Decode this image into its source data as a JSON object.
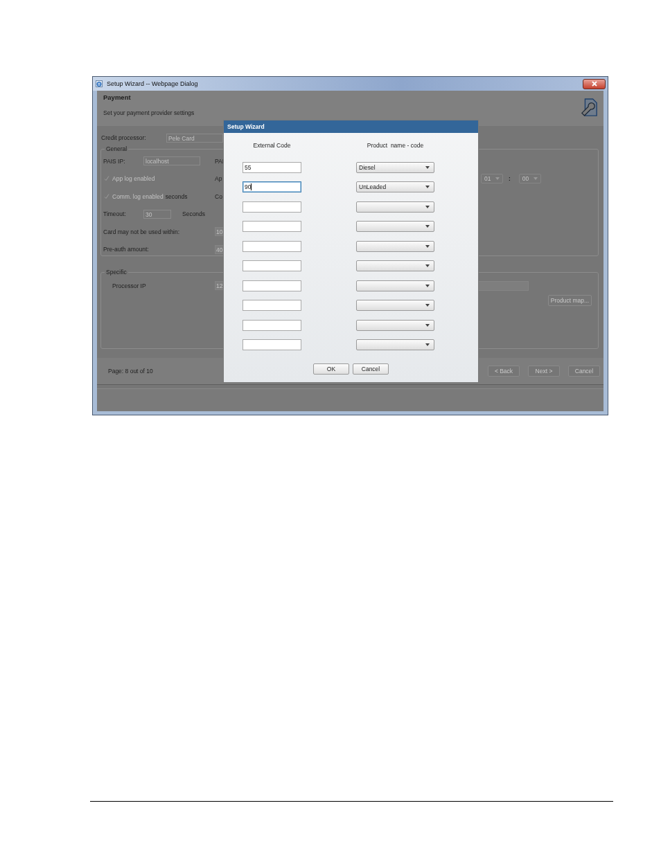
{
  "window": {
    "title": "Setup Wizard -- Webpage Dialog"
  },
  "header": {
    "title": "Payment",
    "subtitle": "Set your payment provider settings"
  },
  "credit_processor": {
    "label": "Credit processor:",
    "value": "Pele Card"
  },
  "general": {
    "legend": "General",
    "rows": [
      {
        "kind": "field",
        "label": "PAIS IP:",
        "value": "localhost",
        "covered_text": "PAI"
      },
      {
        "kind": "check",
        "label": "App log enabled",
        "checked": true,
        "covered_text": "Ap",
        "time": {
          "hour": "01",
          "separator": ":",
          "minute": "00"
        }
      },
      {
        "kind": "check",
        "label": "Comm. log enabled",
        "suffix": "seconds",
        "checked": true,
        "covered_text": "Co"
      },
      {
        "kind": "field",
        "label": "Timeout:",
        "value": "30",
        "suffix": "Seconds"
      },
      {
        "kind": "text",
        "label": "Card may not be used within:",
        "covered_text": "10"
      },
      {
        "kind": "text",
        "label": "Pre-auth amount:",
        "covered_text": "40"
      }
    ]
  },
  "specific": {
    "legend": "Specific",
    "label": "Processor IP",
    "covered_text": "12",
    "button": "Product map..."
  },
  "footer": {
    "page_text": "Page: 8 out of 10",
    "buttons": [
      "< Back",
      "Next >",
      "Cancel"
    ]
  },
  "dialog": {
    "title": "Setup Wizard",
    "columns": [
      "External Code",
      "Product  name - code"
    ],
    "rows": [
      {
        "code": "55",
        "product": "Diesel",
        "focused": false
      },
      {
        "code": "90",
        "product": "UnLeaded",
        "focused": true
      },
      {
        "code": "",
        "product": "",
        "focused": false
      },
      {
        "code": "",
        "product": "",
        "focused": false
      },
      {
        "code": "",
        "product": "",
        "focused": false
      },
      {
        "code": "",
        "product": "",
        "focused": false
      },
      {
        "code": "",
        "product": "",
        "focused": false
      },
      {
        "code": "",
        "product": "",
        "focused": false
      },
      {
        "code": "",
        "product": "",
        "focused": false
      },
      {
        "code": "",
        "product": "",
        "focused": false
      }
    ],
    "buttons": [
      "OK",
      "Cancel"
    ]
  }
}
